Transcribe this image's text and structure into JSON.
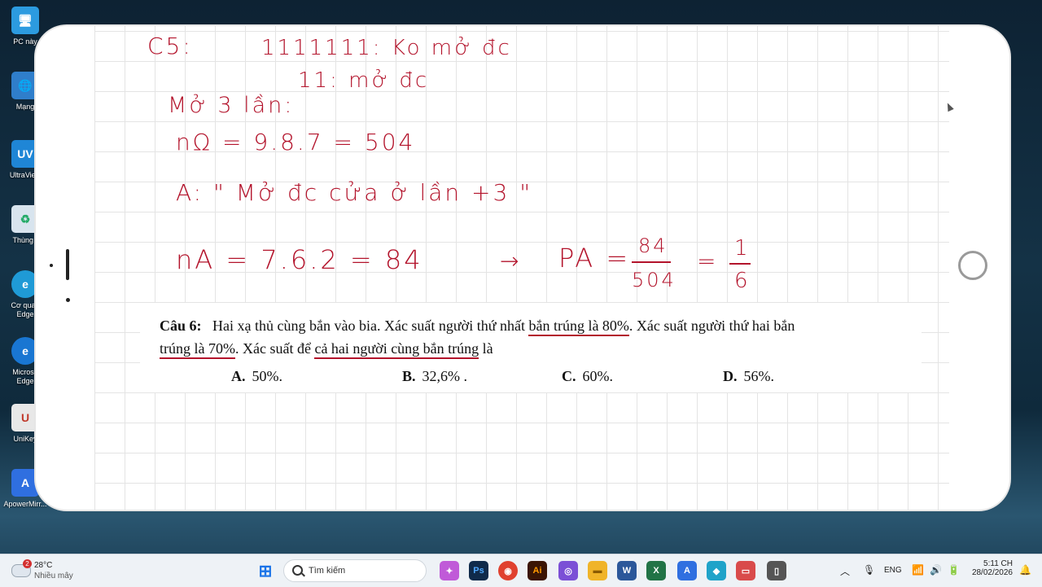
{
  "desktop": {
    "icons": [
      {
        "name": "pc-icon",
        "label": "PC này",
        "color": "#2c9be0",
        "glyph": "🖥"
      },
      {
        "name": "network-icon",
        "label": "Mạng",
        "color": "#2f7ecb",
        "glyph": "🌐"
      },
      {
        "name": "ultraviewer-icon",
        "label": "UltraView",
        "color": "#1f86d6",
        "glyph": "UV"
      },
      {
        "name": "recycle-bin-icon",
        "label": "Thùng r",
        "color": "#d8e4ee",
        "glyph": "♻"
      },
      {
        "name": "edge-work-icon",
        "label": "Cơ quan Edge",
        "color": "#1f9ad6",
        "glyph": "e"
      },
      {
        "name": "edge-icon",
        "label": "Microso Edge",
        "color": "#1976d2",
        "glyph": "e"
      },
      {
        "name": "unikey-icon",
        "label": "UniKey",
        "color": "#e8e8e8",
        "glyph": "U"
      },
      {
        "name": "apowermirror-icon",
        "label": "ApowerMirr...",
        "color": "#2f6fe0",
        "glyph": "A"
      }
    ]
  },
  "note": {
    "line1_left": "C5:",
    "line1_right": "1111111: Ko mở đc",
    "line2": "11: mở đc",
    "line3": "Mở 3 lần:",
    "line4": "nΩ = 9.8.7 = 504",
    "line5": "A: \" Mở đc cửa ở lần +3 \"",
    "line6_left": "nA = 7.6.2 = 84",
    "arrow": "→",
    "pa": "PA =",
    "frac1_num": "84",
    "frac1_den": "504",
    "equals": "=",
    "frac2_num": "1",
    "frac2_den": "6"
  },
  "question": {
    "label": "Câu 6:",
    "text_a": "Hai xạ thủ cùng bắn vào bia. Xác suất người thứ nhất ",
    "text_b": "bắn trúng là 80%",
    "text_c": ". Xác suất người thứ hai bắn",
    "text_d": "trúng là 70%",
    "text_e": ". Xác suất để ",
    "text_f": "cả hai người cùng bắn trúng",
    "text_g": " là",
    "options": [
      {
        "key": "A.",
        "value": "50%."
      },
      {
        "key": "B.",
        "value": "32,6% ."
      },
      {
        "key": "C.",
        "value": "60%."
      },
      {
        "key": "D.",
        "value": "56%."
      }
    ]
  },
  "taskbar": {
    "weather_temp": "28°C",
    "weather_desc": "Nhiều mây",
    "weather_badge": "2",
    "search_placeholder": "Tìm kiếm",
    "lang": "ENG",
    "time": "5:11 CH",
    "date": "28/02/2026",
    "apps": [
      {
        "name": "start-button",
        "glyph": "⊞",
        "color": "#1a73e8"
      },
      {
        "name": "copilot-icon",
        "glyph": "✦",
        "color": "#c05ad8"
      },
      {
        "name": "photoshop-icon",
        "glyph": "Ps",
        "color": "#0f2a4a"
      },
      {
        "name": "chrome-icon",
        "glyph": "◉",
        "color": "#e0412f"
      },
      {
        "name": "illustrator-icon",
        "glyph": "Ai",
        "color": "#3a1505"
      },
      {
        "name": "viber-icon",
        "glyph": "◎",
        "color": "#7b4fd6"
      },
      {
        "name": "file-explorer-icon",
        "glyph": "▬",
        "color": "#f0b429"
      },
      {
        "name": "word-icon",
        "glyph": "W",
        "color": "#2b579a"
      },
      {
        "name": "excel-icon",
        "glyph": "X",
        "color": "#217346"
      },
      {
        "name": "apowermirror-taskbar-icon",
        "glyph": "A",
        "color": "#2f6fe0"
      },
      {
        "name": "app-icon",
        "glyph": "◆",
        "color": "#1fa3c9"
      },
      {
        "name": "screen-recorder-icon",
        "glyph": "▭",
        "color": "#d94b4b"
      },
      {
        "name": "phone-icon",
        "glyph": "▯",
        "color": "#555555"
      }
    ]
  }
}
